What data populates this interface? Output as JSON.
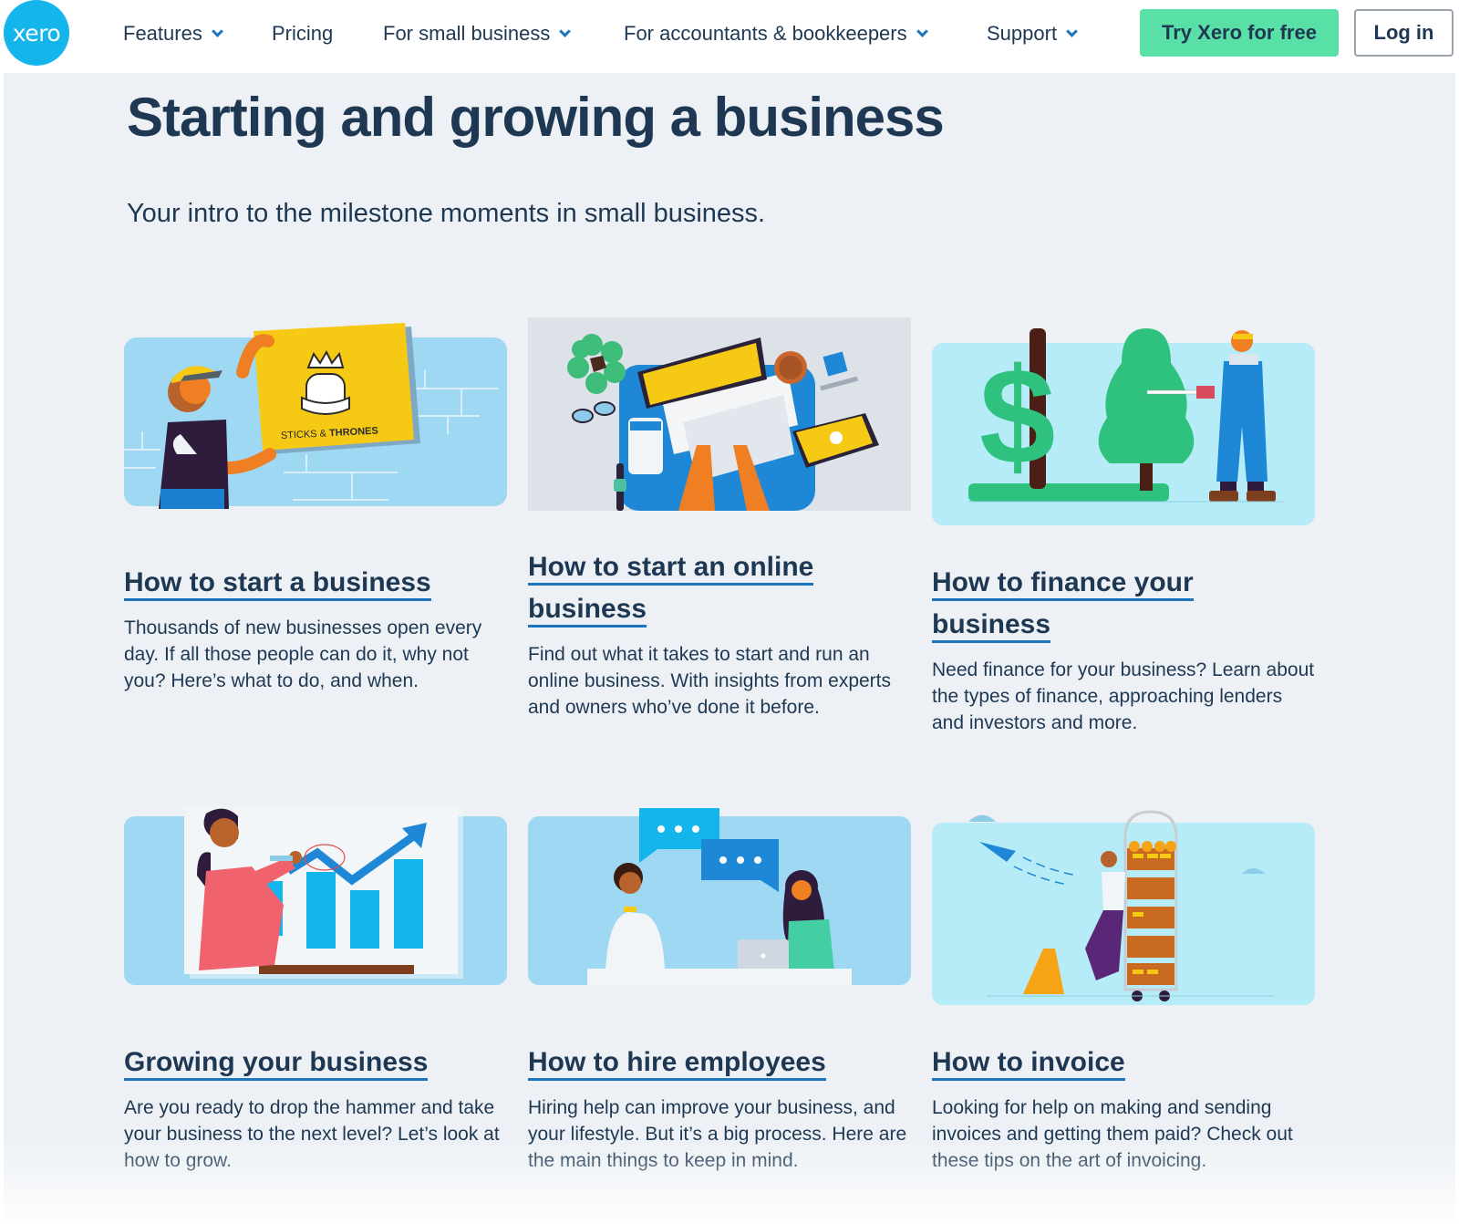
{
  "brand": {
    "logo_text": "xero",
    "accent": "#13b5ea",
    "cta_color": "#59e0a6",
    "text_color": "#1e3853",
    "link_underline": "#1c75bc"
  },
  "nav": {
    "items": [
      {
        "label": "Features",
        "has_dropdown": true
      },
      {
        "label": "Pricing",
        "has_dropdown": false
      },
      {
        "label": "For small business",
        "has_dropdown": true
      },
      {
        "label": "For accountants & bookkeepers",
        "has_dropdown": true
      },
      {
        "label": "Support",
        "has_dropdown": true
      }
    ],
    "cta_label": "Try Xero for free",
    "login_label": "Log in"
  },
  "page": {
    "title": "Starting and growing a business",
    "subtitle": "Your intro to the milestone moments in small business."
  },
  "cards": [
    {
      "title": "How to start a business",
      "description": "Thousands of new businesses open every day. If all those people can do it, why not you? Here’s what to do, and when.",
      "image_label": "STICKS & THRONES"
    },
    {
      "title": "How to start an online business",
      "description": "Find out what it takes to start and run an online business. With insights from experts and owners who’ve done it before."
    },
    {
      "title": "How to finance your business",
      "description": "Need finance for your business? Learn about the types of finance, approaching lenders and investors and more."
    },
    {
      "title": "Growing your business",
      "description": "Are you ready to drop the hammer and take your business to the next level? Let’s look at how to grow."
    },
    {
      "title": "How to hire employees",
      "description": "Hiring help can improve your business, and your lifestyle. But it’s a big process. Here are the main things to keep in mind."
    },
    {
      "title": "How to invoice",
      "description": "Looking for help on making and sending invoices and getting them paid? Check out these tips on the art of invoicing."
    }
  ]
}
